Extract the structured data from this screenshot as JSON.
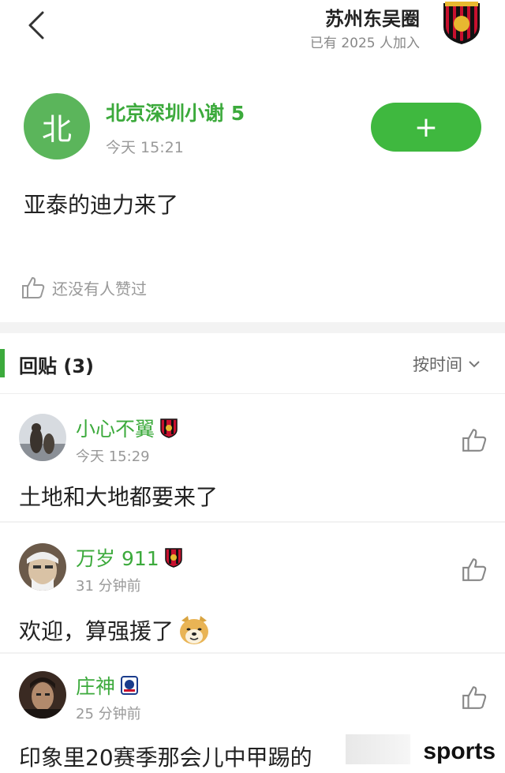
{
  "header": {
    "circle_name": "苏州东吴圈",
    "member_count": "已有 2025 人加入"
  },
  "post": {
    "author_avatar_char": "北",
    "author_name": "北京深圳小谢 5",
    "time": "今天 15:21",
    "follow_label": "+",
    "content": "亚泰的迪力来了",
    "likes_text": "还没有人赞过"
  },
  "replies": {
    "title": "回贴 (3)",
    "sort_label": "按时间",
    "items": [
      {
        "name": "小心不翼",
        "time": "今天 15:29",
        "text": "土地和大地都要来了"
      },
      {
        "name": "万岁 911",
        "time": "31 分钟前",
        "text": "欢迎，算强援了"
      },
      {
        "name": "庄神",
        "time": "25 分钟前",
        "text": "印象里20赛季那会儿中甲踢的"
      }
    ]
  },
  "watermark": "sports",
  "colors": {
    "accent": "#3caa3c",
    "button": "#3fb83f",
    "badge_red": "#b22222"
  }
}
